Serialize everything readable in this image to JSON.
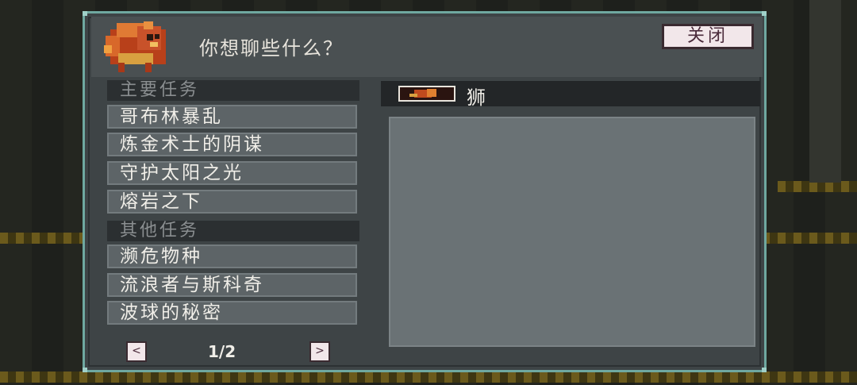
{
  "dialog": {
    "title": "你想聊些什么？",
    "close_label": "关闭"
  },
  "quests": {
    "main_header": "主要任务",
    "main_items": [
      "哥布林暴乱",
      "炼金术士的阴谋",
      "守护太阳之光",
      "熔岩之下"
    ],
    "other_header": "其他任务",
    "other_items": [
      "濒危物种",
      "流浪者与斯科奇",
      "波球的秘密"
    ]
  },
  "npc": {
    "icon": "lion-icon",
    "name": "狮"
  },
  "pagination": {
    "prev_icon": "chevron-left-icon",
    "next_icon": "chevron-right-icon",
    "prev_glyph": "<",
    "next_glyph": ">",
    "page_label": "1/2"
  },
  "colors": {
    "frame": "#6fa8a0",
    "panel": "#3e4446",
    "button_bg": "#f2e7ea"
  }
}
